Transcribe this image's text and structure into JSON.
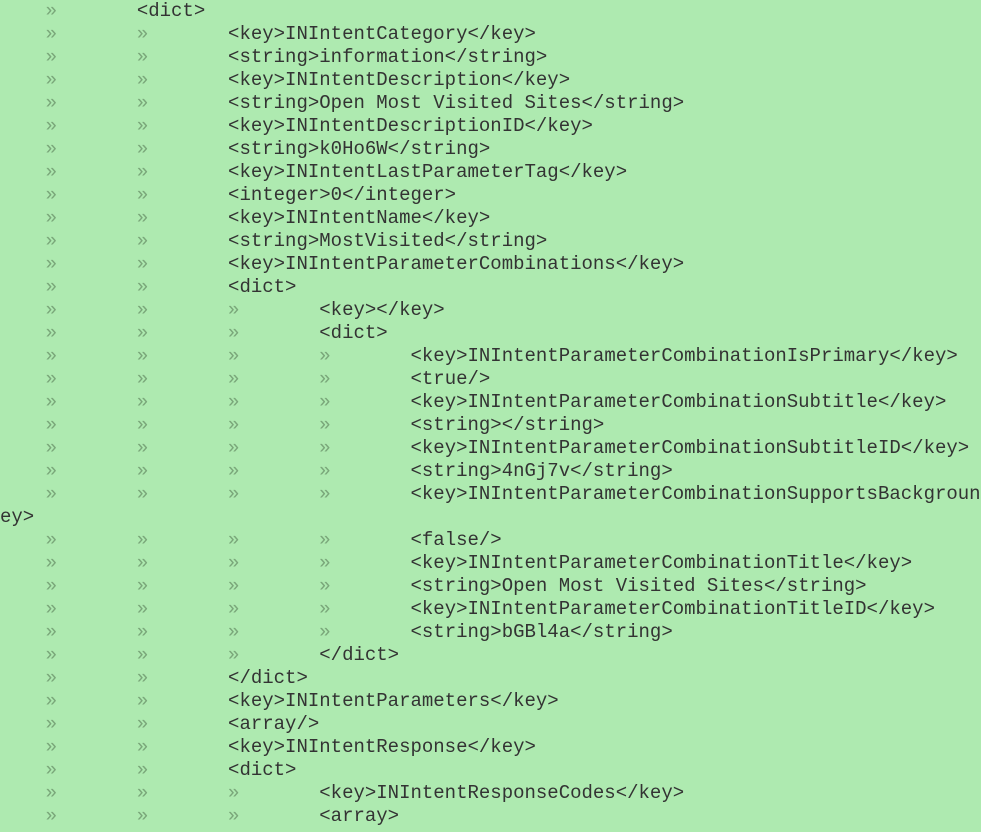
{
  "lines": [
    {
      "tabs": 1,
      "text": "<dict>"
    },
    {
      "tabs": 2,
      "text": "<key>INIntentCategory</key>"
    },
    {
      "tabs": 2,
      "text": "<string>information</string>"
    },
    {
      "tabs": 2,
      "text": "<key>INIntentDescription</key>"
    },
    {
      "tabs": 2,
      "text": "<string>Open Most Visited Sites</string>"
    },
    {
      "tabs": 2,
      "text": "<key>INIntentDescriptionID</key>"
    },
    {
      "tabs": 2,
      "text": "<string>k0Ho6W</string>"
    },
    {
      "tabs": 2,
      "text": "<key>INIntentLastParameterTag</key>"
    },
    {
      "tabs": 2,
      "text": "<integer>0</integer>"
    },
    {
      "tabs": 2,
      "text": "<key>INIntentName</key>"
    },
    {
      "tabs": 2,
      "text": "<string>MostVisited</string>"
    },
    {
      "tabs": 2,
      "text": "<key>INIntentParameterCombinations</key>"
    },
    {
      "tabs": 2,
      "text": "<dict>"
    },
    {
      "tabs": 3,
      "text": "<key></key>"
    },
    {
      "tabs": 3,
      "text": "<dict>"
    },
    {
      "tabs": 4,
      "text": "<key>INIntentParameterCombinationIsPrimary</key>"
    },
    {
      "tabs": 4,
      "text": "<true/>"
    },
    {
      "tabs": 4,
      "text": "<key>INIntentParameterCombinationSubtitle</key>"
    },
    {
      "tabs": 4,
      "text": "<string></string>"
    },
    {
      "tabs": 4,
      "text": "<key>INIntentParameterCombinationSubtitleID</key>"
    },
    {
      "tabs": 4,
      "text": "<string>4nGj7v</string>"
    },
    {
      "tabs": 4,
      "text": "<key>INIntentParameterCombinationSupportsBackgroundExecution",
      "wrap": "ey>"
    },
    {
      "tabs": 4,
      "text": "<false/>"
    },
    {
      "tabs": 4,
      "text": "<key>INIntentParameterCombinationTitle</key>"
    },
    {
      "tabs": 4,
      "text": "<string>Open Most Visited Sites</string>"
    },
    {
      "tabs": 4,
      "text": "<key>INIntentParameterCombinationTitleID</key>"
    },
    {
      "tabs": 4,
      "text": "<string>bGBl4a</string>"
    },
    {
      "tabs": 3,
      "text": "</dict>"
    },
    {
      "tabs": 2,
      "text": "</dict>"
    },
    {
      "tabs": 2,
      "text": "<key>INIntentParameters</key>"
    },
    {
      "tabs": 2,
      "text": "<array/>"
    },
    {
      "tabs": 2,
      "text": "<key>INIntentResponse</key>"
    },
    {
      "tabs": 2,
      "text": "<dict>"
    },
    {
      "tabs": 3,
      "text": "<key>INIntentResponseCodes</key>"
    },
    {
      "tabs": 3,
      "text": "<array>"
    }
  ],
  "tab_visual": "»       ",
  "leading_pad": "    "
}
